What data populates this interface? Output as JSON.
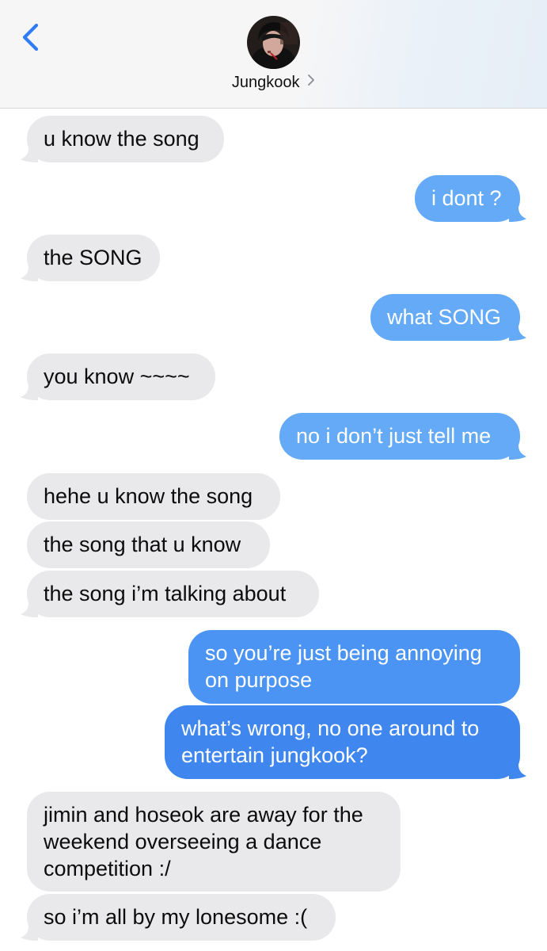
{
  "contact": {
    "name": "Jungkook"
  },
  "colors": {
    "incoming_bubble": "#e9e9eb",
    "outgoing_light": "#64aaf6",
    "outgoing_mid": "#4b94f3",
    "outgoing_dark": "#3f87ef",
    "ios_blue": "#2f7cf6"
  },
  "icons": [
    "back-chevron-icon",
    "chevron-right-icon"
  ],
  "messages": [
    {
      "from": "them",
      "text": "u know the song"
    },
    {
      "from": "me",
      "text": "i dont ?"
    },
    {
      "from": "them",
      "text": "the SONG"
    },
    {
      "from": "me",
      "text": "what SONG"
    },
    {
      "from": "them",
      "text": "you know ~~~~"
    },
    {
      "from": "me",
      "text": "no i don’t just tell me"
    },
    {
      "from": "them",
      "text": "hehe u know the song"
    },
    {
      "from": "them",
      "text": "the song that u know"
    },
    {
      "from": "them",
      "text": "the song i’m talking about"
    },
    {
      "from": "me",
      "lines": [
        "so you’re just being annoying",
        "on purpose"
      ]
    },
    {
      "from": "me",
      "lines": [
        "what’s wrong, no one around to",
        "entertain jungkook?"
      ]
    },
    {
      "from": "them",
      "lines": [
        "jimin and hoseok are away for the",
        "weekend overseeing a dance",
        "competition :/"
      ]
    },
    {
      "from": "them",
      "text": "so i’m all by my lonesome :("
    }
  ]
}
